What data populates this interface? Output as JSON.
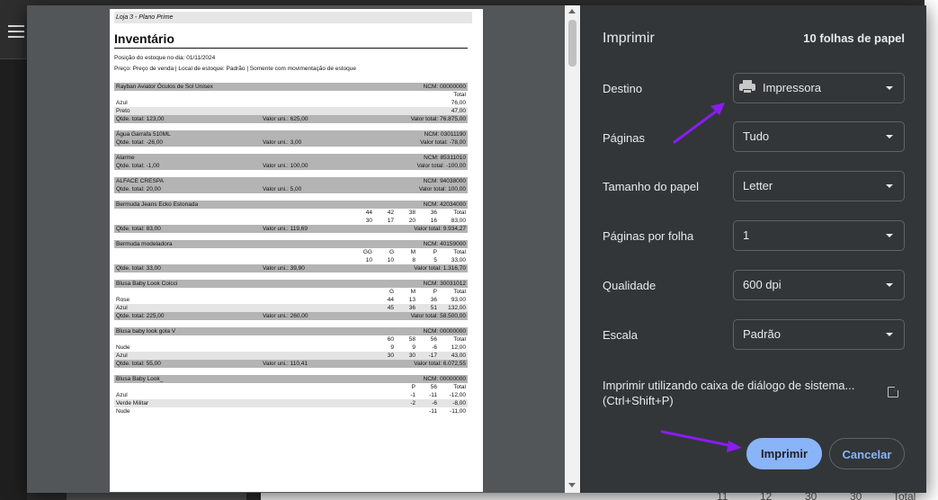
{
  "background": {
    "bottom_values": [
      "11",
      "12",
      "30",
      "30",
      "Total"
    ]
  },
  "preview": {
    "store_header": "Loja 3 - Plano Prime",
    "title": "Inventário",
    "position_date": "Posição do estoque no dia: 01/11/2024",
    "price_info": "Preço: Preço de venda | Local de estoque: Padrão | Somente com movimentação de estoque",
    "items": [
      {
        "name": "Rayban Aviator Óculos de Sol Unisex",
        "ncm": "NCM: 00000000",
        "sizes": [],
        "sizes_total_label": "Total",
        "rows": [
          {
            "label": "Azul",
            "cells": [],
            "total": "76,00"
          },
          {
            "label": "Preto",
            "cells": [],
            "total": "47,00"
          }
        ],
        "qty": "Qtde. total: 123,00",
        "unit": "Valor uni.: 625,00",
        "value": "Valor total: 76.875,00"
      },
      {
        "name": "Água Garrafa 510ML",
        "ncm": "NCM: 03011190",
        "rows": [],
        "qty": "Qtde. total: -26,00",
        "unit": "Valor uni.: 3,00",
        "value": "Valor total: -78,00"
      },
      {
        "name": "Alarme",
        "ncm": "NCM: 85311010",
        "rows": [],
        "qty": "Qtde. total: -1,00",
        "unit": "Valor uni.: 100,00",
        "value": "Valor total: -100,00"
      },
      {
        "name": "ALFACE CRESPA",
        "ncm": "NCM: 94038000",
        "rows": [],
        "qty": "Qtde. total: 20,00",
        "unit": "Valor uni.: 5,00",
        "value": "Valor total: 100,00"
      },
      {
        "name": "Bermuda Jeans Ecko Estonada",
        "ncm": "NCM: 42034000",
        "sizes": [
          "44",
          "42",
          "38",
          "36"
        ],
        "sizes_total_label": "Total",
        "rows": [
          {
            "label": "",
            "cells": [
              "30",
              "17",
              "20",
              "16"
            ],
            "total": "83,00"
          }
        ],
        "qty": "Qtde. total: 83,00",
        "unit": "Valor uni.: 119,69",
        "value": "Valor total: 9.934,27"
      },
      {
        "name": "Bermuda modeladora",
        "ncm": "NCM: 40159000",
        "sizes": [
          "GG",
          "G",
          "M",
          "P"
        ],
        "sizes_total_label": "Total",
        "rows": [
          {
            "label": "",
            "cells": [
              "10",
              "10",
              "8",
              "5"
            ],
            "total": "33,00"
          }
        ],
        "qty": "Qtde. total: 33,00",
        "unit": "Valor uni.: 39,90",
        "value": "Valor total: 1.316,70"
      },
      {
        "name": "Blusa Baby Look Colcci",
        "ncm": "NCM: 30031012",
        "sizes": [
          "G",
          "M",
          "P"
        ],
        "sizes_total_label": "Total",
        "rows": [
          {
            "label": "Rose",
            "cells": [
              "44",
              "13",
              "36"
            ],
            "total": "93,00"
          },
          {
            "label": "Azul",
            "cells": [
              "45",
              "36",
              "51"
            ],
            "total": "132,00"
          }
        ],
        "qty": "Qtde. total: 225,00",
        "unit": "Valor uni.: 260,00",
        "value": "Valor total: 58.500,00"
      },
      {
        "name": "Blusa baby look gola V",
        "ncm": "NCM: 00000000",
        "sizes": [
          "60",
          "58",
          "56"
        ],
        "sizes_total_label": "Total",
        "rows": [
          {
            "label": "Nude",
            "cells": [
              "9",
              "9",
              "-6"
            ],
            "total": "12,00"
          },
          {
            "label": "Azul",
            "cells": [
              "30",
              "30",
              "-17"
            ],
            "total": "43,00"
          }
        ],
        "qty": "Qtde. total: 55,00",
        "unit": "Valor uni.: 110,41",
        "value": "Valor total: 6.072,55"
      },
      {
        "name": "Blusa Baby Look_",
        "ncm": "NCM: 00000000",
        "sizes": [
          "P",
          "56"
        ],
        "sizes_total_label": "Total",
        "rows": [
          {
            "label": "Azul",
            "cells": [
              "-1",
              "-11"
            ],
            "total": "-12,00"
          },
          {
            "label": "Verde Militar",
            "cells": [
              "-2",
              "-6"
            ],
            "total": "-8,00"
          },
          {
            "label": "Nude",
            "cells": [
              "",
              "-11"
            ],
            "total": "-11,00"
          }
        ],
        "qty": "",
        "unit": "",
        "value": ""
      }
    ]
  },
  "settings": {
    "title": "Imprimir",
    "sheets": "10 folhas de papel",
    "destination_label": "Destino",
    "destination_value": "Impressora",
    "pages_label": "Páginas",
    "pages_value": "Tudo",
    "paper_label": "Tamanho do papel",
    "paper_value": "Letter",
    "per_sheet_label": "Páginas por folha",
    "per_sheet_value": "1",
    "quality_label": "Qualidade",
    "quality_value": "600 dpi",
    "scale_label": "Escala",
    "scale_value": "Padrão",
    "system_dialog_line1": "Imprimir utilizando caixa de diálogo de sistema...",
    "system_dialog_line2": "(Ctrl+Shift+P)",
    "print_button": "Imprimir",
    "cancel_button": "Cancelar"
  },
  "colors": {
    "accent": "#8ab4f8",
    "panel": "#323639",
    "annotation_arrow": "#8a1cf0"
  }
}
